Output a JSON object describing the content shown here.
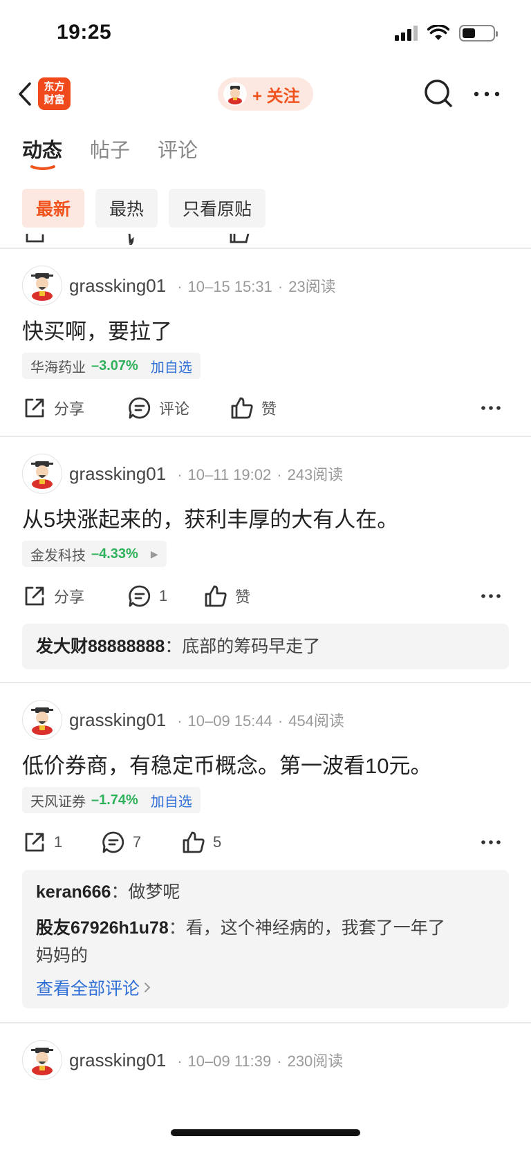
{
  "status_bar": {
    "time": "19:25"
  },
  "nav": {
    "logo_line1": "东方",
    "logo_line2": "财富",
    "follow_label": "+ 关注"
  },
  "tabs": [
    {
      "label": "动态",
      "active": true
    },
    {
      "label": "帖子",
      "active": false
    },
    {
      "label": "评论",
      "active": false
    }
  ],
  "filters": [
    {
      "label": "最新",
      "active": true
    },
    {
      "label": "最热",
      "active": false
    },
    {
      "label": "只看原贴",
      "active": false
    }
  ],
  "colors": {
    "accent": "#f0541e",
    "stock_down": "#2fb15c",
    "link": "#2f6fd6"
  },
  "posts": [
    {
      "username": "grassking01",
      "datetime": "10–15 15:31",
      "reads": "23阅读",
      "text": "快买啊，要拉了",
      "stock": {
        "name": "华海药业",
        "change": "–3.07%",
        "action": "加自选"
      },
      "share_label": "分享",
      "comment_label": "评论",
      "like_label": "赞"
    },
    {
      "username": "grassking01",
      "datetime": "10–11 19:02",
      "reads": "243阅读",
      "text": "从5块涨起来的，获利丰厚的大有人在。",
      "stock": {
        "name": "金发科技",
        "change": "–4.33%"
      },
      "share_label": "分享",
      "comment_label": "1",
      "like_label": "赞",
      "comments": [
        {
          "user": "发大财88888888",
          "sep": "：",
          "text": "底部的筹码早走了"
        }
      ]
    },
    {
      "username": "grassking01",
      "datetime": "10–09 15:44",
      "reads": "454阅读",
      "text": "低价券商，有稳定币概念。第一波看10元。",
      "stock": {
        "name": "天风证券",
        "change": "–1.74%",
        "action": "加自选"
      },
      "share_label": "1",
      "comment_label": "7",
      "like_label": "5",
      "comments": [
        {
          "user": "keran666",
          "sep": "：",
          "text": "做梦呢"
        },
        {
          "user": "股友67926h1u78",
          "sep": "：",
          "text": "看，这个神经病的，我套了一年了",
          "text2": "妈妈的"
        }
      ],
      "view_all": "查看全部评论"
    },
    {
      "username": "grassking01",
      "datetime": "10–09 11:39",
      "reads": "230阅读"
    }
  ]
}
